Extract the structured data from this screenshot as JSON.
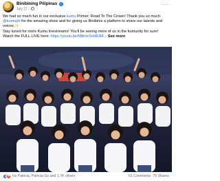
{
  "post": {
    "page_name": "Binibining Pilipinas",
    "verified": "✓",
    "date": "July 27",
    "caption": {
      "line1_a": "We had so much fun in our exclusive ",
      "line1_b": "kumu",
      "line1_c": " Primer: Road To The Crown! Thank you so much",
      "line2_a": "@kumuph",
      "line2_b": " for the amazing show and for giving us Binibinis a platform to share our talents and",
      "line3": "voices ✨",
      "line4": "Stay tuned for more Kumu livestreams! You'll be seeing more of us in the kumunity for sure!",
      "line5_a": "Watch the FULL LIVE here: ",
      "line5_link": "https://youtu.be/M8meSxHE4l8...",
      "see_more": "See more"
    },
    "reactors_text": "Ira Patricia, Patricia Go and 1.7K others",
    "comments_text": "61 Comments",
    "shares_text": "75 Shares"
  },
  "icons": {
    "like": "like-icon",
    "love": "love-icon",
    "more": "more-icon",
    "globe": "globe-icon"
  },
  "colors": {
    "link": "#216fdb",
    "like": "#1877f2",
    "love": "#f33e58",
    "muted": "#65676b"
  }
}
